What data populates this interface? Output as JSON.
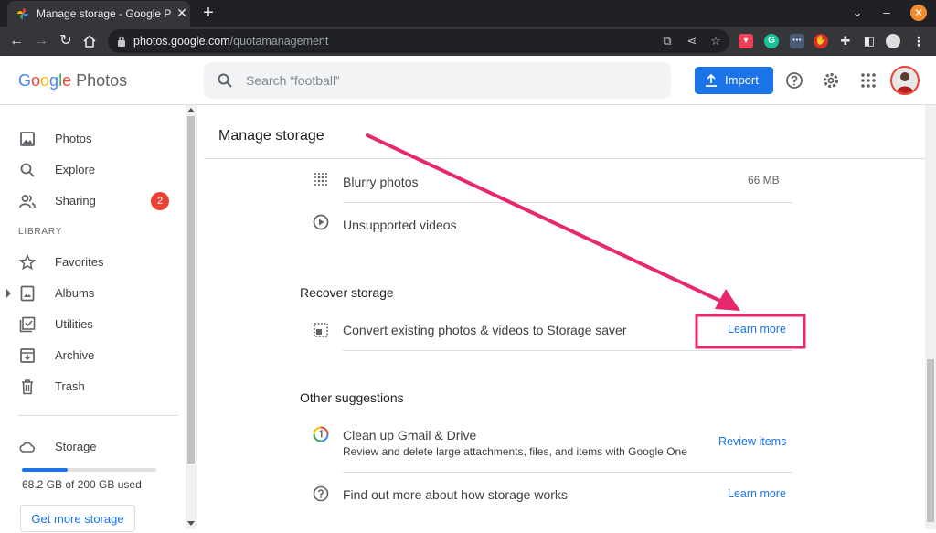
{
  "browser": {
    "tab_title": "Manage storage - Google Photos",
    "url_host": "photos.google.com",
    "url_path": "/quotamanagement"
  },
  "header": {
    "logo_google": [
      "G",
      "o",
      "o",
      "g",
      "l",
      "e"
    ],
    "logo_photos": "Photos",
    "search_placeholder": "Search “football”",
    "import_label": "Import"
  },
  "sidebar": {
    "items": [
      {
        "label": "Photos",
        "icon": "photo-icon"
      },
      {
        "label": "Explore",
        "icon": "search-icon"
      },
      {
        "label": "Sharing",
        "icon": "people-icon",
        "badge": "2"
      }
    ],
    "library_label": "LIBRARY",
    "library_items": [
      {
        "label": "Favorites",
        "icon": "star-icon"
      },
      {
        "label": "Albums",
        "icon": "album-icon"
      },
      {
        "label": "Utilities",
        "icon": "checklist-icon"
      },
      {
        "label": "Archive",
        "icon": "archive-icon"
      },
      {
        "label": "Trash",
        "icon": "trash-icon"
      }
    ],
    "storage": {
      "label": "Storage",
      "used_text": "68.2 GB of 200 GB used",
      "fraction": 0.341,
      "button": "Get more storage"
    }
  },
  "main": {
    "title": "Manage storage",
    "rows": [
      {
        "label": "Blurry photos",
        "size": "66 MB",
        "icon": "blur-icon"
      },
      {
        "label": "Unsupported videos",
        "icon": "play-circle-icon"
      }
    ],
    "recover": {
      "title": "Recover storage",
      "row_label": "Convert existing photos & videos to Storage saver",
      "link": "Learn more"
    },
    "suggestions": {
      "title": "Other suggestions",
      "items": [
        {
          "title": "Clean up Gmail & Drive",
          "subtitle": "Review and delete large attachments, files, and items with Google One",
          "link": "Review items"
        },
        {
          "title": "Find out more about how storage works",
          "link": "Learn more"
        }
      ]
    }
  },
  "colors": {
    "accent": "#1a73e8",
    "annotation": "#e8286e",
    "badge": "#ea4335"
  }
}
